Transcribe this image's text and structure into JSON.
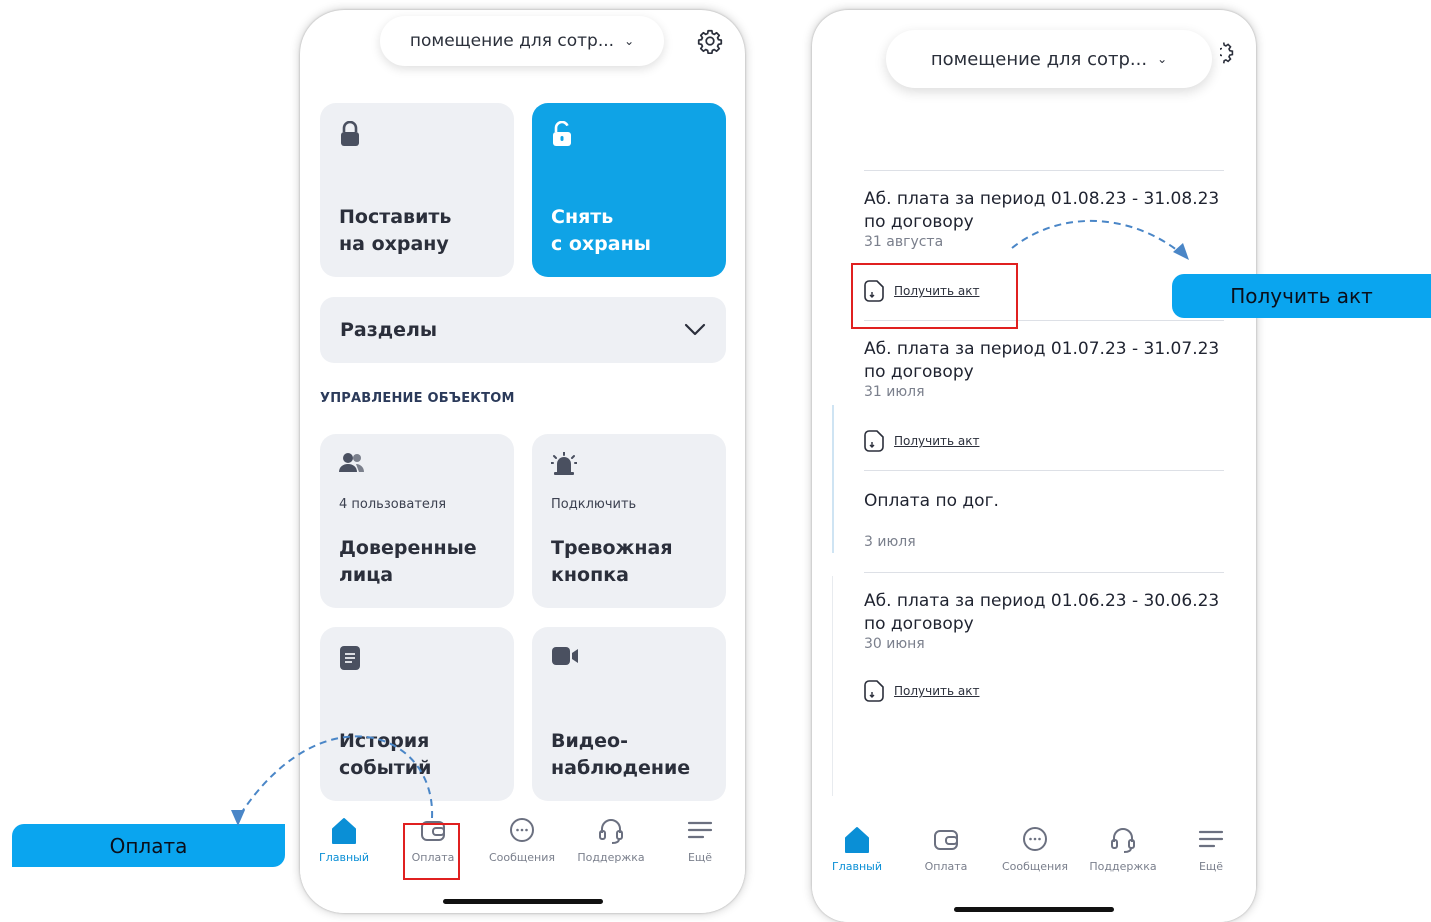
{
  "phone1": {
    "object_selector": "помещение для сотр...",
    "arm_tile": {
      "line1": "Поставить",
      "line2": "на охрану"
    },
    "disarm_tile": {
      "line1": "Снять",
      "line2": "с охраны"
    },
    "sections": "Разделы",
    "section_label": "УПРАВЛЕНИЕ ОБЪЕКТОМ",
    "trusted": {
      "sub": "4 пользователя",
      "line1": "Доверенные",
      "line2": "лица"
    },
    "panic": {
      "sub": "Подключить",
      "line1": "Тревожная",
      "line2": "кнопка"
    },
    "history": {
      "line1": "История",
      "line2": "событий"
    },
    "video": {
      "line1": "Видео-",
      "line2": "наблюдение"
    },
    "tabs": [
      "Главный",
      "Оплата",
      "Сообщения",
      "Поддержка",
      "Ещё"
    ]
  },
  "phone2": {
    "object_selector": "помещение для сотр...",
    "items": [
      {
        "line1": "Аб. плата за период 01.08.23 - 31.08.23",
        "line2": "по договору",
        "date": "31 августа",
        "link": "Получить акт"
      },
      {
        "line1": "Аб. плата за период 01.07.23 - 31.07.23",
        "line2": "по договору",
        "date": "31 июля",
        "link": "Получить акт"
      },
      {
        "line1": "Оплата по дог.",
        "line2": "",
        "date": "3 июля",
        "link": ""
      },
      {
        "line1": "Аб. плата за период 01.06.23 - 30.06.23",
        "line2": "по договору",
        "date": "30 июня",
        "link": "Получить акт"
      }
    ],
    "tabs": [
      "Главный",
      "Оплата",
      "Сообщения",
      "Поддержка",
      "Ещё"
    ]
  },
  "callouts": {
    "payment": "Оплата",
    "get_act": "Получить акт"
  },
  "colors": {
    "accent": "#0fa3e6",
    "callout": "#0aa5ef",
    "tile": "#eef0f4",
    "highlight": "#e02020",
    "arrow": "#4a86c7"
  }
}
